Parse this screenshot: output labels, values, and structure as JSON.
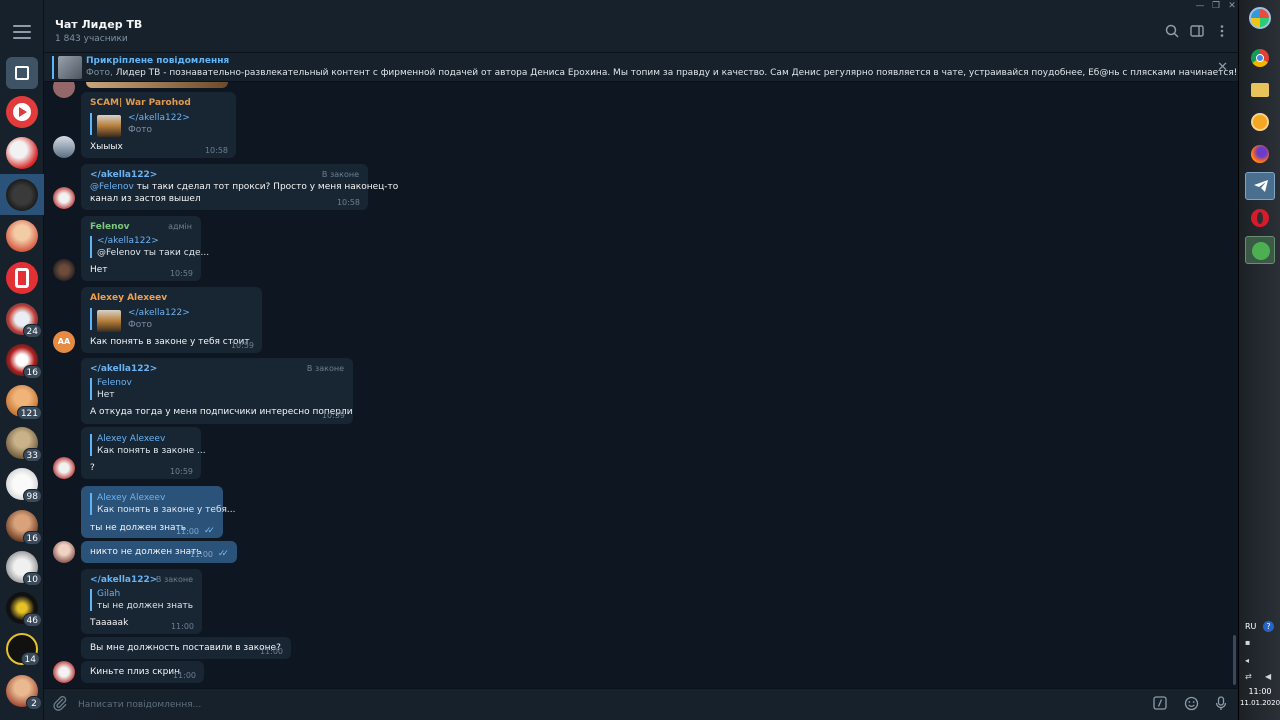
{
  "window": {
    "minimize": "—",
    "restore": "❐",
    "close": "✕"
  },
  "header": {
    "title": "Чат Лидер ТВ",
    "subtitle": "1 843 учасники"
  },
  "pinned": {
    "label": "Прикріплене повідомлення",
    "prefix": "Фото,",
    "text": " Лидер ТВ - познавательно-развлекательный контент с фирменной подачей от автора Дениса Ерохина. Мы топим за правду и качество.  Сам Денис регулярно появляется в чате, устраивайся поудобнее, Еб@нь с плясками начинается!"
  },
  "folders": {
    "badges": [
      "24",
      "16",
      "121",
      "33",
      "98",
      "16",
      "10",
      "46",
      "14",
      "2"
    ]
  },
  "messages": [
    {
      "sender": "SCAM| War Parohod",
      "reply_name": "</akella122>",
      "reply_text": "Фото",
      "text": "Хыыых",
      "time": "10:58"
    },
    {
      "sender": "</akella122>",
      "role": "В законе",
      "mention": "@Felenov",
      "text": " ты таки сделал тот прокси? Просто у меня наконец-то",
      "text2": "канал из застоя вышел",
      "time": "10:58"
    },
    {
      "sender": "Felenov",
      "role": "адмін",
      "reply_name": "</akella122>",
      "reply_text": "@Felenov ты таки сде...",
      "text": "Нет",
      "time": "10:59"
    },
    {
      "sender": "Alexey Alexeev",
      "avatar": "AA",
      "reply_name": "</akella122>",
      "reply_text": "Фото",
      "text": "Как понять в законе у тебя стоит",
      "time": "10:59"
    },
    {
      "sender": "</akella122>",
      "role": "В законе",
      "reply_name": "Felenov",
      "reply_text": "Нет",
      "text": "А откуда тогда у меня подписчики интересно поперли",
      "time": "10:59"
    },
    {
      "reply_name": "Alexey Alexeev",
      "reply_text": "Как понять в законе ...",
      "text": "?",
      "time": "10:59"
    },
    {
      "reply_name": "Alexey Alexeev",
      "reply_text": "Как понять в законе у тебя...",
      "text": "ты не должен знать",
      "time": "11:00"
    },
    {
      "text": "никто не должен знать",
      "time": "11:00"
    },
    {
      "sender": "</akella122>",
      "role": "В законе",
      "reply_name": "Gilah",
      "reply_text": "ты не должен знать",
      "text": "Таааaak",
      "time": "11:00"
    },
    {
      "text": "Вы мне должность поставили в законе?",
      "time": "11:00"
    },
    {
      "text": "Киньте плиз скрин",
      "time": "11:00"
    }
  ],
  "composer": {
    "placeholder": "Написати повідомлення..."
  },
  "taskbar": {
    "lang": "RU",
    "help": "?",
    "time": "11:00",
    "date": "11.01.2020"
  },
  "colors": {
    "sender_scam": "#e39a4f",
    "sender_akella": "#6ab3f3",
    "sender_felenov": "#7fc77e",
    "sender_alexey": "#f0a04e",
    "avatar_aa": "#e58c42"
  }
}
